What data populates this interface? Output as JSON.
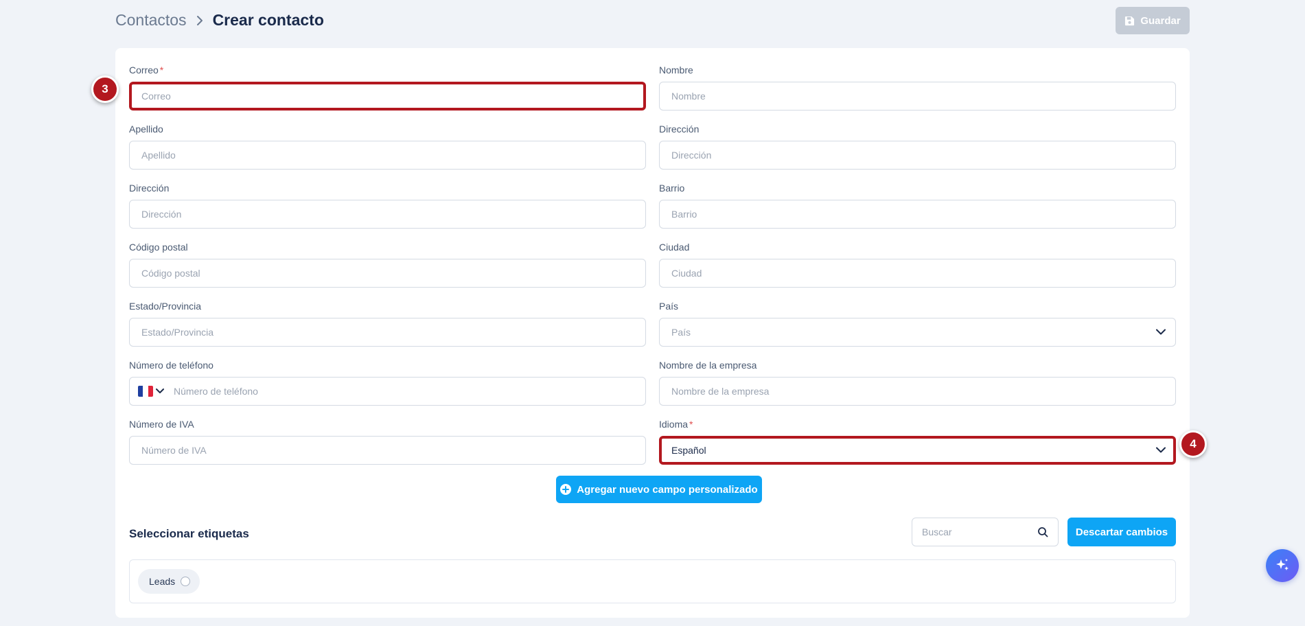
{
  "breadcrumb": {
    "parent": "Contactos",
    "current": "Crear contacto"
  },
  "toolbar": {
    "save_label": "Guardar"
  },
  "form": {
    "fields": [
      {
        "label": "Correo",
        "placeholder": "Correo",
        "required": true
      },
      {
        "label": "Nombre",
        "placeholder": "Nombre"
      },
      {
        "label": "Apellido",
        "placeholder": "Apellido"
      },
      {
        "label": "Dirección",
        "placeholder": "Dirección"
      },
      {
        "label": "Dirección",
        "placeholder": "Dirección"
      },
      {
        "label": "Barrio",
        "placeholder": "Barrio"
      },
      {
        "label": "Código postal",
        "placeholder": "Código postal"
      },
      {
        "label": "Ciudad",
        "placeholder": "Ciudad"
      },
      {
        "label": "Estado/Provincia",
        "placeholder": "Estado/Provincia"
      },
      {
        "label": "País",
        "placeholder": "País"
      },
      {
        "label": "Número de teléfono",
        "placeholder": "Número de teléfono"
      },
      {
        "label": "Nombre de la empresa",
        "placeholder": "Nombre de la empresa"
      },
      {
        "label": "Número de IVA",
        "placeholder": "Número de IVA"
      },
      {
        "label": "Idioma",
        "value": "Español",
        "required": true
      }
    ],
    "required_mark": "*"
  },
  "annotations": {
    "badge_correo": "3",
    "badge_idioma": "4"
  },
  "custom_field_button": "Agregar nuevo campo personalizado",
  "tags": {
    "title": "Seleccionar etiquetas",
    "search_placeholder": "Buscar",
    "discard_label": "Descartar cambios",
    "items": [
      {
        "label": "Leads"
      }
    ]
  },
  "colors": {
    "accent": "#0ea5f5",
    "highlight": "#b3181f",
    "background": "#f0f3f8",
    "disabled": "#c5ccd6"
  },
  "icons": {
    "breadcrumb_sep": "chevron-right-icon",
    "save": "floppy-disk-icon",
    "select": "chevron-down-icon",
    "flag": "france-flag-icon",
    "add": "plus-circle-icon",
    "search": "search-icon",
    "assistant": "sparkles-icon"
  }
}
